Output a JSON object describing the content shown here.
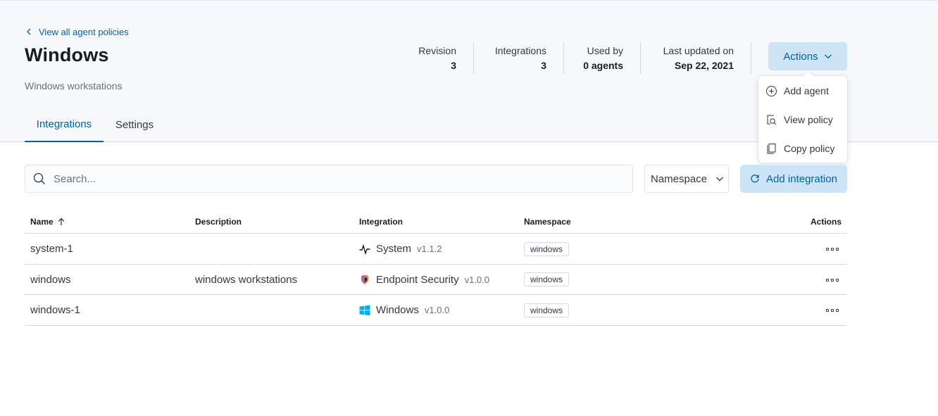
{
  "header": {
    "back_link": "View all agent policies",
    "title": "Windows",
    "description": "Windows workstations",
    "stats": [
      {
        "label": "Revision",
        "value": "3"
      },
      {
        "label": "Integrations",
        "value": "3"
      },
      {
        "label": "Used by",
        "value": "0 agents"
      },
      {
        "label": "Last updated on",
        "value": "Sep 22, 2021"
      }
    ],
    "actions_label": "Actions"
  },
  "actions_menu": {
    "items": [
      {
        "label": "Add agent",
        "icon": "plus-in-circle-icon"
      },
      {
        "label": "View policy",
        "icon": "inspect-icon"
      },
      {
        "label": "Copy policy",
        "icon": "copy-icon"
      }
    ]
  },
  "tabs": [
    {
      "label": "Integrations",
      "active": true
    },
    {
      "label": "Settings",
      "active": false
    }
  ],
  "toolbar": {
    "search_placeholder": "Search...",
    "namespace_label": "Namespace",
    "add_integration_label": "Add integration"
  },
  "table": {
    "columns": [
      "Name",
      "Description",
      "Integration",
      "Namespace",
      "Actions"
    ],
    "rows": [
      {
        "name": "system-1",
        "description": "",
        "integration": "System",
        "version": "v1.1.2",
        "icon": "system-activity-icon",
        "namespace": "windows"
      },
      {
        "name": "windows",
        "description": "windows workstations",
        "integration": "Endpoint Security",
        "version": "v1.0.0",
        "icon": "endpoint-security-icon",
        "namespace": "windows"
      },
      {
        "name": "windows-1",
        "description": "",
        "integration": "Windows",
        "version": "v1.0.0",
        "icon": "windows-logo-icon",
        "namespace": "windows"
      }
    ]
  },
  "colors": {
    "link": "#0061a6",
    "button_bg": "#cce4f5",
    "header_bg": "#f7f8fc",
    "border": "#d3dae6"
  }
}
